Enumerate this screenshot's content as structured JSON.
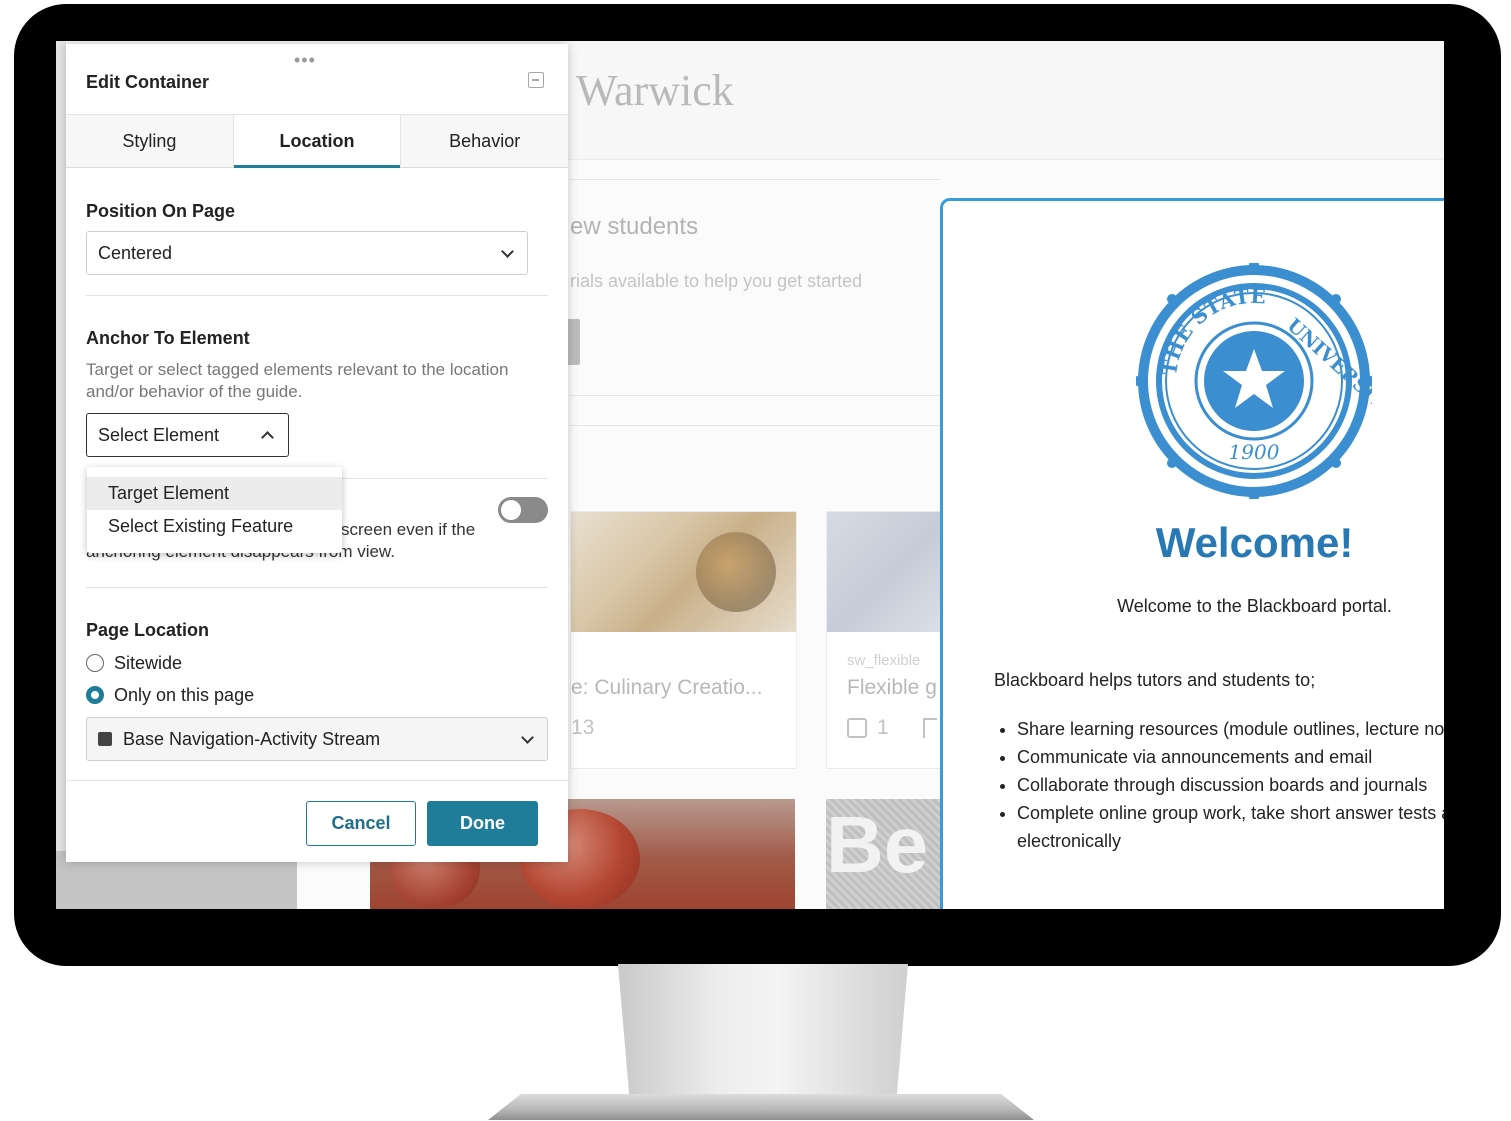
{
  "panel": {
    "title": "Edit Container",
    "tabs": [
      {
        "label": "Styling",
        "active": false
      },
      {
        "label": "Location",
        "active": true
      },
      {
        "label": "Behavior",
        "active": false
      }
    ],
    "position_on_page": {
      "label": "Position On Page",
      "value": "Centered"
    },
    "anchor": {
      "label": "Anchor To Element",
      "helper": "Target or select tagged elements relevant to the location and/or behavior of the guide.",
      "select_value": "Select Element",
      "dropdown_options": [
        "Target Element",
        "Select Existing Feature"
      ],
      "highlighted_option": "Target Element"
    },
    "floating": {
      "desc_partial": "screen even if the",
      "desc_line2": "anchoring element disappears from view.",
      "toggle_on": false
    },
    "page_location": {
      "label": "Page Location",
      "options": [
        {
          "label": "Sitewide",
          "checked": false
        },
        {
          "label": "Only on this page",
          "checked": true
        }
      ],
      "page_select_value": "Base Navigation-Activity Stream"
    },
    "buttons": {
      "cancel": "Cancel",
      "done": "Done"
    }
  },
  "background_page": {
    "site_title": "Warwick",
    "section_title": "ew students",
    "section_subtitle": "rials available to help you get started",
    "cards": [
      {
        "title": "e: Culinary Creatio...",
        "meta": "13"
      },
      {
        "tag": "sw_flexible",
        "title": "Flexible g",
        "meta": "1"
      }
    ],
    "card_overlay_text": "Be"
  },
  "welcome": {
    "seal": {
      "top_text": "THE STATE",
      "right_text": "UNIVERSITY",
      "year": "1900"
    },
    "title": "Welcome!",
    "text": "Welcome to the Blackboard portal.",
    "intro": "Blackboard helps tutors and students to;",
    "items": [
      "Share learning resources (module outlines, lecture notes, assignment briefs etc.)",
      "Communicate via announcements and email",
      "Collaborate through discussion boards and journals",
      "Complete online group work, take short answer tests and submit coursework electronically"
    ]
  },
  "colors": {
    "accent": "#1f7d99",
    "welcome_blue": "#2878b4",
    "seal_blue": "#3b8fd0"
  }
}
